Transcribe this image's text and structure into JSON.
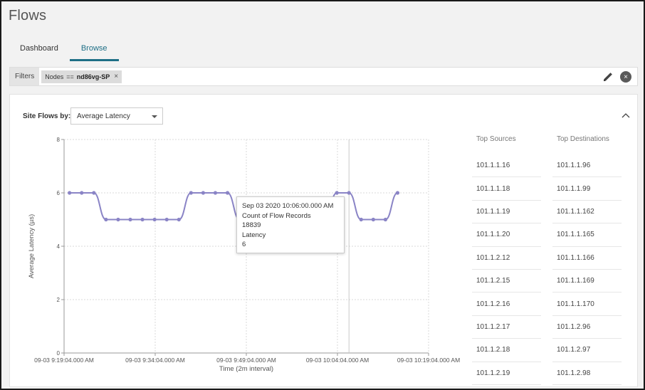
{
  "page": {
    "title": "Flows"
  },
  "tabs": [
    {
      "label": "Dashboard",
      "active": false
    },
    {
      "label": "Browse",
      "active": true
    }
  ],
  "filters": {
    "label": "Filters",
    "chip": {
      "key": "Nodes",
      "op": "==",
      "value": "nd86vg-SP",
      "remove": "×"
    },
    "clear": "×"
  },
  "site_flows": {
    "label": "Site Flows by:",
    "selected": "Average Latency"
  },
  "tooltip": {
    "time": "Sep 03 2020 10:06:00.000 AM",
    "count_label": "Count of Flow Records",
    "count_value": "18839",
    "latency_label": "Latency",
    "latency_value": "6"
  },
  "top_sources": {
    "header": "Top Sources",
    "items": [
      "101.1.1.16",
      "101.1.1.18",
      "101.1.1.19",
      "101.1.1.20",
      "101.1.2.12",
      "101.1.2.15",
      "101.1.2.16",
      "101.1.2.17",
      "101.1.2.18",
      "101.1.2.19"
    ]
  },
  "top_destinations": {
    "header": "Top Destinations",
    "items": [
      "101.1.1.96",
      "101.1.1.99",
      "101.1.1.162",
      "101.1.1.165",
      "101.1.1.166",
      "101.1.1.169",
      "101.1.1.170",
      "101.1.2.96",
      "101.1.2.97",
      "101.1.2.98"
    ]
  },
  "chart_data": {
    "type": "line",
    "xlabel": "Time (2m interval)",
    "ylabel": "Average Latency (µs)",
    "ylim": [
      0,
      8
    ],
    "yticks": [
      0,
      2,
      4,
      6,
      8
    ],
    "xlim_minutes": [
      0,
      60
    ],
    "xticks": [
      {
        "m": 0,
        "label": "09-03 9:19:04.000 AM"
      },
      {
        "m": 15,
        "label": "09-03 9:34:04.000 AM"
      },
      {
        "m": 30,
        "label": "09-03 9:49:04.000 AM"
      },
      {
        "m": 45,
        "label": "09-03 10:04:04.000 AM"
      },
      {
        "m": 60,
        "label": "09-03 10:19:04.000 AM"
      }
    ],
    "grid": true,
    "line_color": "#8a84c6",
    "series": [
      {
        "points": [
          [
            0.9,
            6
          ],
          [
            2.9,
            6
          ],
          [
            4.9,
            6
          ],
          [
            6.9,
            5
          ],
          [
            8.9,
            5
          ],
          [
            10.9,
            5
          ],
          [
            12.9,
            5
          ],
          [
            14.9,
            5
          ],
          [
            16.9,
            5
          ],
          [
            18.9,
            5
          ],
          [
            20.9,
            6
          ],
          [
            22.9,
            6
          ],
          [
            24.9,
            6
          ],
          [
            26.9,
            6
          ],
          [
            28.9,
            5
          ],
          [
            30.9,
            5
          ],
          [
            32.9,
            5
          ],
          [
            34.9,
            5
          ],
          [
            36.9,
            5
          ],
          [
            38.9,
            5
          ],
          [
            40.9,
            5
          ],
          [
            42.9,
            5
          ],
          [
            44.9,
            6
          ],
          [
            46.9,
            6
          ],
          [
            48.9,
            5
          ],
          [
            50.9,
            5
          ],
          [
            52.9,
            5
          ],
          [
            54.9,
            6
          ]
        ]
      }
    ],
    "hover_x_minutes": 46.9
  }
}
